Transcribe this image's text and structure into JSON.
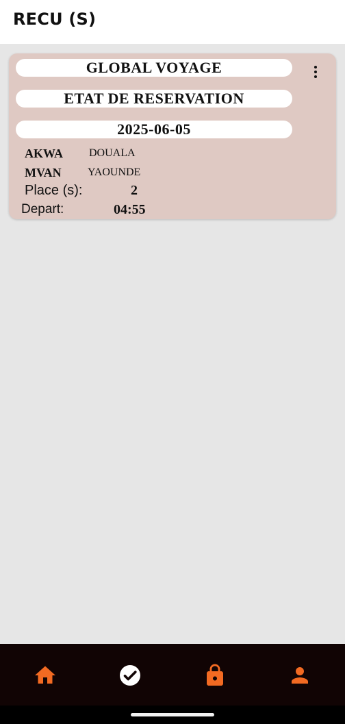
{
  "app_bar": {
    "title": "RECU (S)"
  },
  "receipt": {
    "company": "GLOBAL VOYAGE",
    "status_title": "ETAT DE RESERVATION",
    "date": "2025-06-05",
    "departure": {
      "code": "AKWA",
      "city": "DOUALA"
    },
    "arrival": {
      "code": "MVAN",
      "city": "YAOUNDE"
    },
    "places_label": "Place (s):",
    "places_value": "2",
    "depart_label": "Depart:",
    "depart_time": "04:55",
    "menu_icon": "more-vert-icon"
  },
  "bottom_nav": {
    "items": [
      {
        "icon": "home-icon",
        "color": "#f26a22"
      },
      {
        "icon": "check-circle-icon",
        "color": "#ffffff"
      },
      {
        "icon": "lock-icon",
        "color": "#f26a22"
      },
      {
        "icon": "person-icon",
        "color": "#f26a22"
      }
    ]
  },
  "colors": {
    "card_background": "#dfc9c3",
    "accent": "#f26a22",
    "nav_background": "#110404",
    "page_background": "#e6e6e6"
  }
}
